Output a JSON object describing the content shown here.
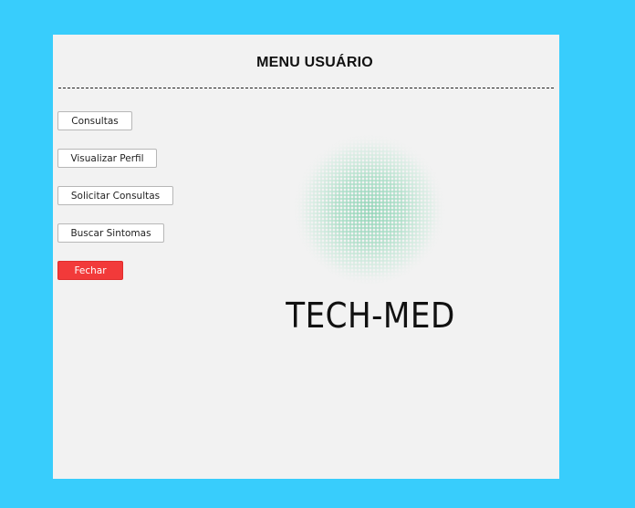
{
  "window": {
    "title": "MENU USUÁRIO"
  },
  "menu": {
    "buttons": [
      {
        "label": "Consultas"
      },
      {
        "label": "Visualizar Perfil"
      },
      {
        "label": "Solicitar Consultas"
      },
      {
        "label": "Buscar Sintomas"
      },
      {
        "label": "Fechar"
      }
    ]
  },
  "brand": {
    "name": "TECH-MED",
    "logo_icon": "halftone-circle-logo",
    "logo_color": "#8fd4b6"
  },
  "colors": {
    "background": "#38cdfc",
    "panel": "#f2f2f2",
    "close_button": "#f23a3a"
  }
}
